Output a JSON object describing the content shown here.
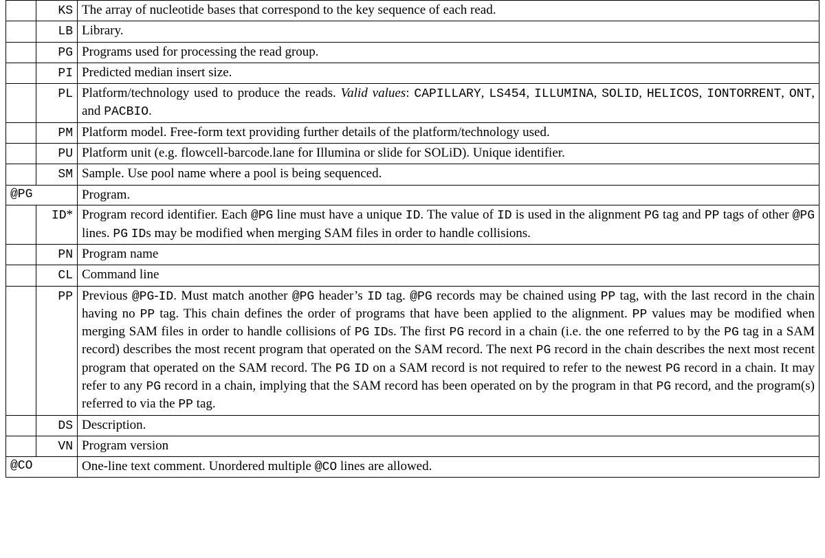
{
  "rows": [
    {
      "kind": "tag",
      "tag": "KS",
      "desc": [
        {
          "t": "text",
          "v": "The array of nucleotide bases that correspond to the key sequence of each read."
        }
      ]
    },
    {
      "kind": "tag",
      "tag": "LB",
      "desc": [
        {
          "t": "text",
          "v": "Library."
        }
      ]
    },
    {
      "kind": "tag",
      "tag": "PG",
      "desc": [
        {
          "t": "text",
          "v": "Programs used for processing the read group."
        }
      ]
    },
    {
      "kind": "tag",
      "tag": "PI",
      "desc": [
        {
          "t": "text",
          "v": "Predicted median insert size."
        }
      ]
    },
    {
      "kind": "tag",
      "tag": "PL",
      "desc": [
        {
          "t": "text",
          "v": "Platform/technology used to produce the reads. "
        },
        {
          "t": "ital",
          "v": "Valid values"
        },
        {
          "t": "text",
          "v": ": "
        },
        {
          "t": "code",
          "v": "CAPILLARY"
        },
        {
          "t": "text",
          "v": ", "
        },
        {
          "t": "code",
          "v": "LS454"
        },
        {
          "t": "text",
          "v": ", "
        },
        {
          "t": "code",
          "v": "ILLUMINA"
        },
        {
          "t": "text",
          "v": ", "
        },
        {
          "t": "code",
          "v": "SOLID"
        },
        {
          "t": "text",
          "v": ", "
        },
        {
          "t": "code",
          "v": "HELICOS"
        },
        {
          "t": "text",
          "v": ", "
        },
        {
          "t": "code",
          "v": "IONTORRENT"
        },
        {
          "t": "text",
          "v": ", "
        },
        {
          "t": "code",
          "v": "ONT"
        },
        {
          "t": "text",
          "v": ", and "
        },
        {
          "t": "code",
          "v": "PACBIO"
        },
        {
          "t": "text",
          "v": "."
        }
      ]
    },
    {
      "kind": "tag",
      "tag": "PM",
      "desc": [
        {
          "t": "text",
          "v": "Platform model. Free-form text providing further details of the platform/technology used."
        }
      ]
    },
    {
      "kind": "tag",
      "tag": "PU",
      "desc": [
        {
          "t": "text",
          "v": "Platform unit (e.g. flowcell-barcode.lane for Illumina or slide for SOLiD). Unique identifier."
        }
      ]
    },
    {
      "kind": "tag",
      "tag": "SM",
      "desc": [
        {
          "t": "text",
          "v": "Sample. Use pool name where a pool is being sequenced."
        }
      ]
    },
    {
      "kind": "group",
      "tag": "@PG",
      "desc": [
        {
          "t": "text",
          "v": "Program."
        }
      ]
    },
    {
      "kind": "tag",
      "tag": "ID",
      "star": true,
      "desc": [
        {
          "t": "text",
          "v": "Program record identifier. Each "
        },
        {
          "t": "code",
          "v": "@PG"
        },
        {
          "t": "text",
          "v": " line must have a unique "
        },
        {
          "t": "code",
          "v": "ID"
        },
        {
          "t": "text",
          "v": ". The value of "
        },
        {
          "t": "code",
          "v": "ID"
        },
        {
          "t": "text",
          "v": " is used in the alignment "
        },
        {
          "t": "code",
          "v": "PG"
        },
        {
          "t": "text",
          "v": " tag and "
        },
        {
          "t": "code",
          "v": "PP"
        },
        {
          "t": "text",
          "v": " tags of other "
        },
        {
          "t": "code",
          "v": "@PG"
        },
        {
          "t": "text",
          "v": " lines. "
        },
        {
          "t": "code",
          "v": "PG"
        },
        {
          "t": "text",
          "v": " "
        },
        {
          "t": "code",
          "v": "ID"
        },
        {
          "t": "text",
          "v": "s may be modified when merging SAM files in order to handle collisions."
        }
      ]
    },
    {
      "kind": "tag",
      "tag": "PN",
      "desc": [
        {
          "t": "text",
          "v": "Program name"
        }
      ]
    },
    {
      "kind": "tag",
      "tag": "CL",
      "desc": [
        {
          "t": "text",
          "v": "Command line"
        }
      ]
    },
    {
      "kind": "tag",
      "tag": "PP",
      "desc": [
        {
          "t": "text",
          "v": "Previous "
        },
        {
          "t": "code",
          "v": "@PG"
        },
        {
          "t": "text",
          "v": "-"
        },
        {
          "t": "code",
          "v": "ID"
        },
        {
          "t": "text",
          "v": ". Must match another "
        },
        {
          "t": "code",
          "v": "@PG"
        },
        {
          "t": "text",
          "v": " header’s "
        },
        {
          "t": "code",
          "v": "ID"
        },
        {
          "t": "text",
          "v": " tag. "
        },
        {
          "t": "code",
          "v": "@PG"
        },
        {
          "t": "text",
          "v": " records may be chained using "
        },
        {
          "t": "code",
          "v": "PP"
        },
        {
          "t": "text",
          "v": " tag, with the last record in the chain having no "
        },
        {
          "t": "code",
          "v": "PP"
        },
        {
          "t": "text",
          "v": " tag. This chain defines the order of programs that have been applied to the alignment. "
        },
        {
          "t": "code",
          "v": "PP"
        },
        {
          "t": "text",
          "v": " values may be modified when merging SAM files in order to handle collisions of "
        },
        {
          "t": "code",
          "v": "PG"
        },
        {
          "t": "text",
          "v": " "
        },
        {
          "t": "code",
          "v": "ID"
        },
        {
          "t": "text",
          "v": "s. The first "
        },
        {
          "t": "code",
          "v": "PG"
        },
        {
          "t": "text",
          "v": " record in a chain (i.e. the one referred to by the "
        },
        {
          "t": "code",
          "v": "PG"
        },
        {
          "t": "text",
          "v": " tag in a SAM record) describes the most recent program that operated on the SAM record. The next "
        },
        {
          "t": "code",
          "v": "PG"
        },
        {
          "t": "text",
          "v": " record in the chain describes the next most recent program that operated on the SAM record. The "
        },
        {
          "t": "code",
          "v": "PG"
        },
        {
          "t": "text",
          "v": " "
        },
        {
          "t": "code",
          "v": "ID"
        },
        {
          "t": "text",
          "v": " on a SAM record is not required to refer to the newest "
        },
        {
          "t": "code",
          "v": "PG"
        },
        {
          "t": "text",
          "v": " record in a chain. It may refer to any "
        },
        {
          "t": "code",
          "v": "PG"
        },
        {
          "t": "text",
          "v": " record in a chain, implying that the SAM record has been operated on by the program in that "
        },
        {
          "t": "code",
          "v": "PG"
        },
        {
          "t": "text",
          "v": " record, and the program(s) referred to via the "
        },
        {
          "t": "code",
          "v": "PP"
        },
        {
          "t": "text",
          "v": " tag."
        }
      ]
    },
    {
      "kind": "tag",
      "tag": "DS",
      "desc": [
        {
          "t": "text",
          "v": "Description."
        }
      ]
    },
    {
      "kind": "tag",
      "tag": "VN",
      "desc": [
        {
          "t": "text",
          "v": "Program version"
        }
      ]
    },
    {
      "kind": "group",
      "tag": "@CO",
      "desc": [
        {
          "t": "text",
          "v": "One-line text comment. Unordered multiple "
        },
        {
          "t": "code",
          "v": "@CO"
        },
        {
          "t": "text",
          "v": " lines are allowed."
        }
      ]
    }
  ]
}
